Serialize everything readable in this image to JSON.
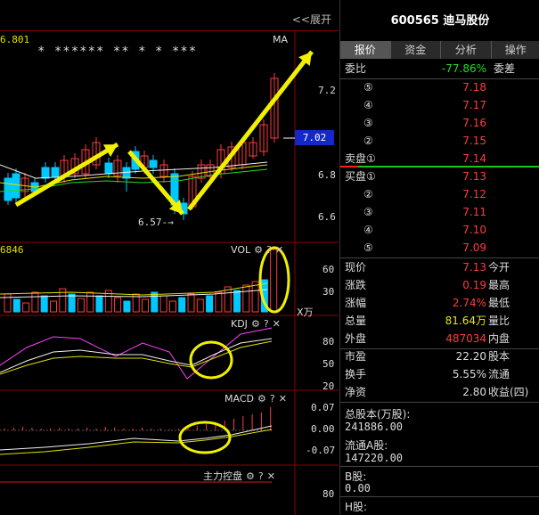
{
  "chart": {
    "expand_label": "<<展开",
    "price_top": "6.801",
    "stars": "*  ******  **  *  *    ***",
    "ma_label": "MA",
    "price_axis": [
      "7.2",
      "7.02",
      "6.8",
      "6.6"
    ],
    "low_marker": "6.57",
    "vol_left_value": "6846",
    "vol_title": "VOL",
    "vol_axis": [
      "60",
      "30",
      "X万"
    ],
    "kdj_title": "KDJ",
    "kdj_axis": [
      "80",
      "50",
      "20"
    ],
    "macd_title": "MACD",
    "macd_axis": [
      "0.07",
      "0.00",
      "-0.07"
    ],
    "zlkp_title": "主力控盘",
    "zlkp_axis": [
      "80"
    ],
    "icons": [
      "gear-icon",
      "help-icon",
      "close-icon"
    ]
  },
  "quote": {
    "code": "600565",
    "name": "迪马股份",
    "tabs": [
      "报价",
      "资金",
      "分析",
      "操作"
    ],
    "weibi": {
      "label": "委比",
      "value": "-77.86%",
      "label2": "委差"
    },
    "sell": [
      {
        "label": "⑤",
        "price": "7.18"
      },
      {
        "label": "④",
        "price": "7.17"
      },
      {
        "label": "③",
        "price": "7.16"
      },
      {
        "label": "②",
        "price": "7.15"
      },
      {
        "label": "卖盘①",
        "price": "7.14"
      }
    ],
    "buy": [
      {
        "label": "买盘①",
        "price": "7.13"
      },
      {
        "label": "②",
        "price": "7.12"
      },
      {
        "label": "③",
        "price": "7.11"
      },
      {
        "label": "④",
        "price": "7.10"
      },
      {
        "label": "⑤",
        "price": "7.09"
      }
    ],
    "stats": [
      {
        "label": "现价",
        "value": "7.13",
        "label2": "今开",
        "color": "red"
      },
      {
        "label": "涨跌",
        "value": "0.19",
        "label2": "最高",
        "color": "red"
      },
      {
        "label": "涨幅",
        "value": "2.74%",
        "label2": "最低",
        "color": "red"
      },
      {
        "label": "总量",
        "value": "81.64万",
        "label2": "量比",
        "color": "yellow"
      },
      {
        "label": "外盘",
        "value": "487034",
        "label2": "内盘",
        "color": "red"
      }
    ],
    "fundamentals": [
      {
        "label": "市盈",
        "value": "22.20",
        "label2": "股本"
      },
      {
        "label": "换手",
        "value": "5.55%",
        "label2": "流通"
      },
      {
        "label": "净资",
        "value": "2.80",
        "label2": "收益(四)"
      }
    ],
    "total_shares_label": "总股本(万股):",
    "total_shares_value": "241886.00",
    "float_a_label": "流通A股:",
    "float_a_value": "147220.00",
    "b_label": "B股:",
    "b_value": "0.00",
    "h_label": "H股:"
  }
}
